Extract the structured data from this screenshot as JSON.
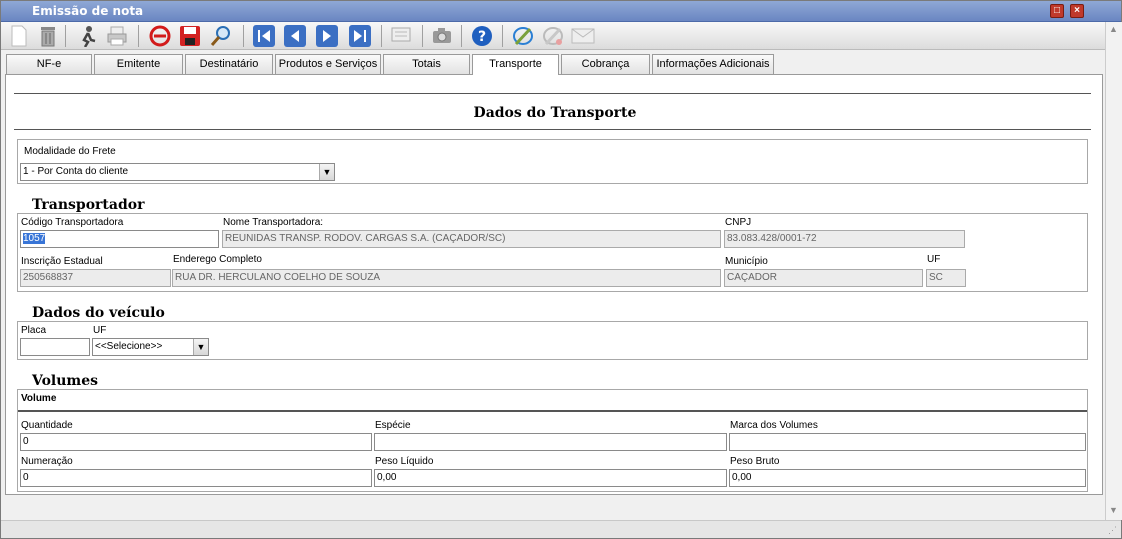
{
  "window": {
    "title": "Emissão de nota"
  },
  "toolbar": {
    "icons": [
      "new-doc-icon",
      "trash-icon",
      "run-icon",
      "print-icon",
      "cancel-icon",
      "save-icon",
      "search-icon",
      "first-icon",
      "prev-icon",
      "next-icon",
      "last-icon",
      "preview-icon",
      "camera-icon",
      "help-icon",
      "edit-icon",
      "edit-disabled-icon",
      "email-icon"
    ]
  },
  "tabs": [
    "NF-e",
    "Emitente",
    "Destinatário",
    "Produtos e Serviços",
    "Totais",
    "Transporte",
    "Cobrança",
    "Informações Adicionais"
  ],
  "active_tab": "Transporte",
  "page": {
    "heading": "Dados do Transporte"
  },
  "frete": {
    "label": "Modalidade do Frete",
    "value": "1 - Por Conta do cliente"
  },
  "transportador": {
    "title": "Transportador",
    "codigo_label": "Código Transportadora",
    "codigo": "1057",
    "nome_label": "Nome Transportadora:",
    "nome": "REUNIDAS TRANSP. RODOV. CARGAS S.A. (CAÇADOR/SC)",
    "cnpj_label": "CNPJ",
    "cnpj": "83.083.428/0001-72",
    "ie_label": "Inscrição Estadual",
    "ie": "250568837",
    "endereco_label": "Enderego Completo",
    "endereco": "RUA DR. HERCULANO COELHO DE SOUZA",
    "municipio_label": "Município",
    "municipio": "CAÇADOR",
    "uf_label": "UF",
    "uf": "SC"
  },
  "veiculo": {
    "title": "Dados do veículo",
    "placa_label": "Placa",
    "placa": "",
    "uf_label": "UF",
    "uf": "<<Selecione>>"
  },
  "volumes": {
    "title": "Volumes",
    "subtitle": "Volume",
    "quantidade_label": "Quantidade",
    "quantidade": "0",
    "especie_label": "Espécie",
    "especie": "",
    "marca_label": "Marca dos Volumes",
    "marca": "",
    "numeracao_label": "Numeração",
    "numeracao": "0",
    "peso_liquido_label": "Peso Líquido",
    "peso_liquido": "0,00",
    "peso_bruto_label": "Peso Bruto",
    "peso_bruto": "0,00"
  }
}
